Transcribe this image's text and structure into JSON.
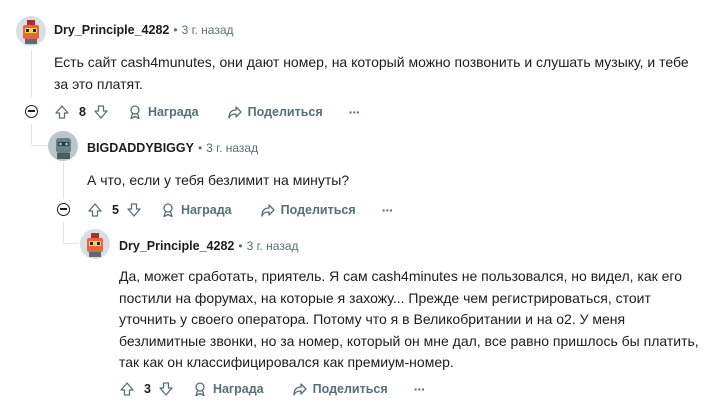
{
  "comments": [
    {
      "author": "Dry_Principle_4282",
      "separator": "•",
      "time": "3 г. назад",
      "text": "Есть сайт cash4munutes, они дают номер, на который можно позвонить и слушать музыку, и тебе за это платят.",
      "votes": "8",
      "award": "Награда",
      "share": "Поделиться",
      "more": "···"
    },
    {
      "author": "BIGDADDYBIGGY",
      "separator": "•",
      "time": "3 г. назад",
      "text": "А что, если у тебя безлимит на минуты?",
      "votes": "5",
      "award": "Награда",
      "share": "Поделиться",
      "more": "···"
    },
    {
      "author": "Dry_Principle_4282",
      "separator": "•",
      "time": "3 г. назад",
      "text": "Да, может сработать, приятель. Я сам cash4minutes не пользовался, но видел, как его постили на форумах, на которые я захожу... Прежде чем регистрироваться, стоит уточнить у своего оператора. Потому что я в Великобритании и на o2. У меня безлимитные звонки, но за номер, который он мне дал, все равно пришлось бы платить, так как он классифицировался как премиум-номер.",
      "votes": "3",
      "award": "Награда",
      "share": "Поделиться",
      "more": "···"
    }
  ],
  "colors": {
    "text": "#1c1c1c",
    "meta": "#576f76",
    "thread_line": "#dfe3e6",
    "avatar1_bg": "#d7dfe2",
    "avatar2_bg": "#b9c7cc"
  }
}
